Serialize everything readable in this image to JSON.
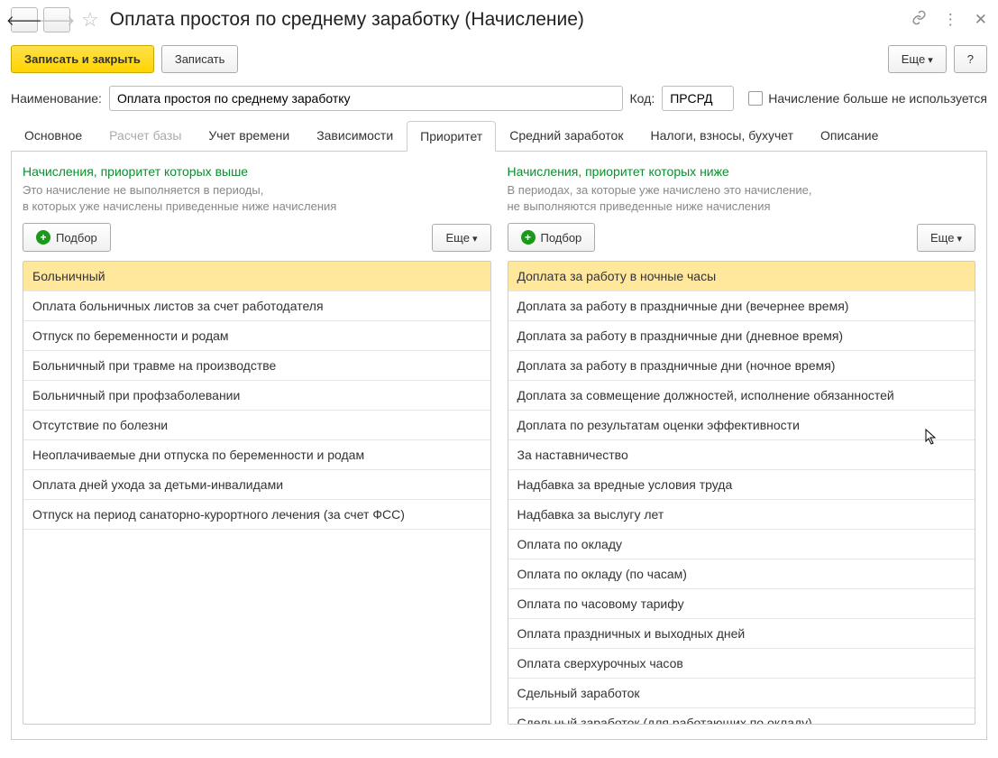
{
  "header": {
    "title": "Оплата простоя по среднему заработку (Начисление)"
  },
  "toolbar": {
    "write_close": "Записать и закрыть",
    "write": "Записать",
    "more": "Еще",
    "help": "?"
  },
  "form": {
    "name_label": "Наименование:",
    "name_value": "Оплата простоя по среднему заработку",
    "code_label": "Код:",
    "code_value": "ПРСРД",
    "not_used_label": "Начисление больше не используется"
  },
  "tabs": [
    {
      "label": "Основное",
      "active": false
    },
    {
      "label": "Расчет базы",
      "active": false,
      "disabled": true
    },
    {
      "label": "Учет времени",
      "active": false
    },
    {
      "label": "Зависимости",
      "active": false
    },
    {
      "label": "Приоритет",
      "active": true
    },
    {
      "label": "Средний заработок",
      "active": false
    },
    {
      "label": "Налоги, взносы, бухучет",
      "active": false
    },
    {
      "label": "Описание",
      "active": false
    }
  ],
  "priority": {
    "higher": {
      "title": "Начисления, приоритет которых выше",
      "desc1": "Это начисление не выполняется в периоды,",
      "desc2": "в которых уже начислены приведенные ниже начисления",
      "selection": "Подбор",
      "more": "Еще",
      "items": [
        "Больничный",
        "Оплата больничных листов за счет работодателя",
        "Отпуск по беременности и родам",
        "Больничный при травме на производстве",
        "Больничный при профзаболевании",
        "Отсутствие по болезни",
        "Неоплачиваемые дни отпуска по беременности и родам",
        "Оплата дней ухода за детьми-инвалидами",
        "Отпуск на период санаторно-курортного лечения (за счет ФСС)"
      ]
    },
    "lower": {
      "title": "Начисления, приоритет которых ниже",
      "desc1": "В периодах, за которые уже начислено это начисление,",
      "desc2": "не выполняются приведенные ниже начисления",
      "selection": "Подбор",
      "more": "Еще",
      "items": [
        "Доплата за работу в ночные часы",
        "Доплата за работу в праздничные дни (вечернее время)",
        "Доплата за работу в праздничные дни (дневное время)",
        "Доплата за работу в праздничные дни (ночное время)",
        "Доплата за совмещение должностей, исполнение обязанностей",
        "Доплата по результатам оценки эффективности",
        "За наставничество",
        "Надбавка за вредные условия труда",
        "Надбавка за выслугу лет",
        "Оплата по окладу",
        "Оплата по окладу (по часам)",
        "Оплата по часовому тарифу",
        "Оплата праздничных и выходных дней",
        "Оплата сверхурочных часов",
        "Сдельный заработок",
        "Сдельный заработок (для работающих по окладу)"
      ]
    }
  }
}
